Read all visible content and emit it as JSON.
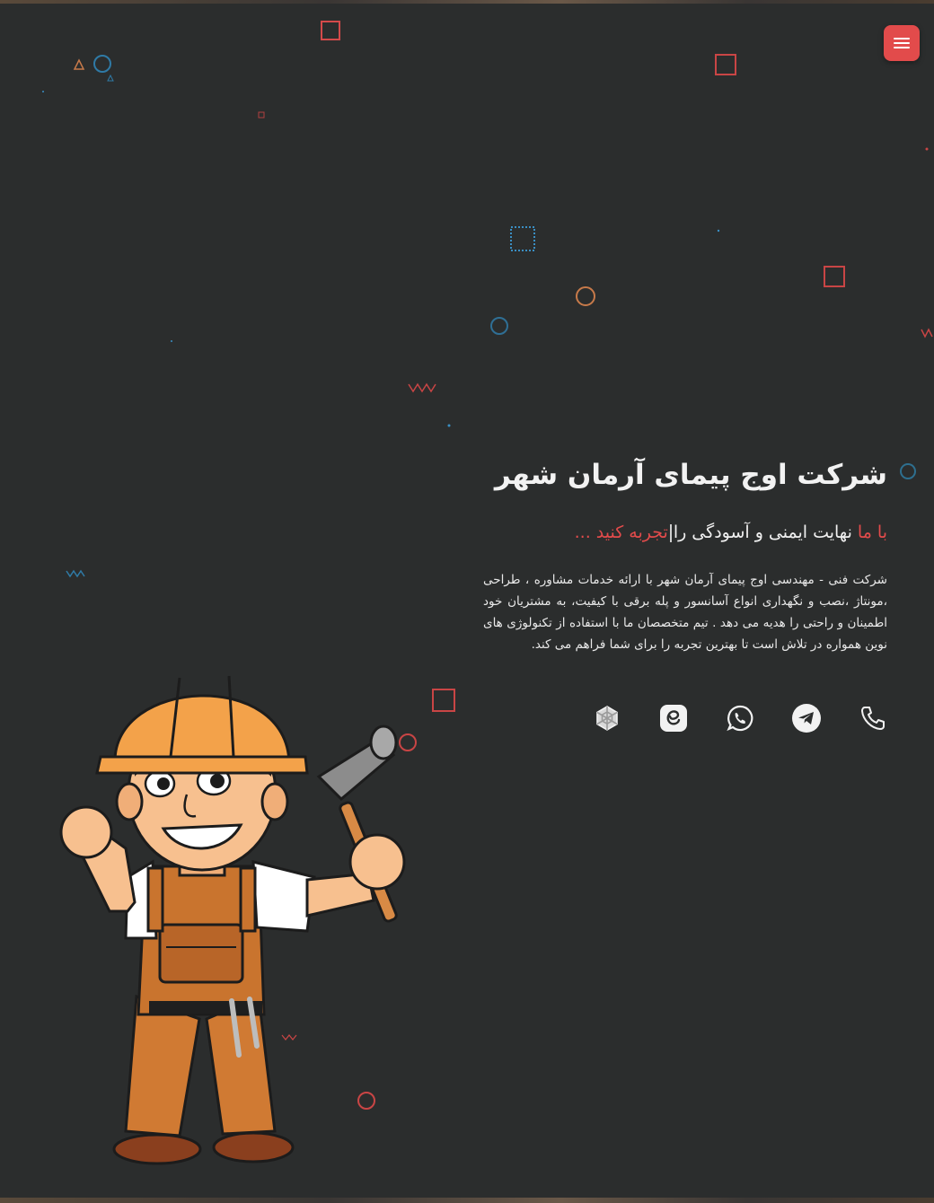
{
  "header": {
    "menu_icon": "hamburger-icon",
    "accent_color": "#e24b4b"
  },
  "hero": {
    "title": "شرکت اوج پیمای آرمان شهر",
    "subtitle_prefix": "با ما",
    "subtitle_middle": "نهایت ایمنی و آسودگی را",
    "subtitle_typed": "تجربه کنید ...",
    "description": "شرکت فنی - مهندسی اوج پیمای آرمان شهر با ارائه خدمات مشاوره ، طراحی ،مونتاژ ،نصب و نگهداری انواع آسانسور و پله برقی با کیفیت، به مشتریان خود اطمینان و راحتی را هدیه می دهد . تیم متخصصان ما با استفاده از تکنولوژی های نوین همواره در تلاش است تا بهترین تجربه را برای شما فراهم می کند."
  },
  "socials": [
    {
      "icon": "phone-icon"
    },
    {
      "icon": "telegram-icon"
    },
    {
      "icon": "whatsapp-icon"
    },
    {
      "icon": "eitaa-icon"
    },
    {
      "icon": "rubika-icon"
    }
  ],
  "illustration": {
    "icon": "worker-mascot-icon",
    "colors": {
      "helmet": "#f3a24a",
      "overalls": "#c9742e",
      "skin": "#f7c08f"
    }
  }
}
